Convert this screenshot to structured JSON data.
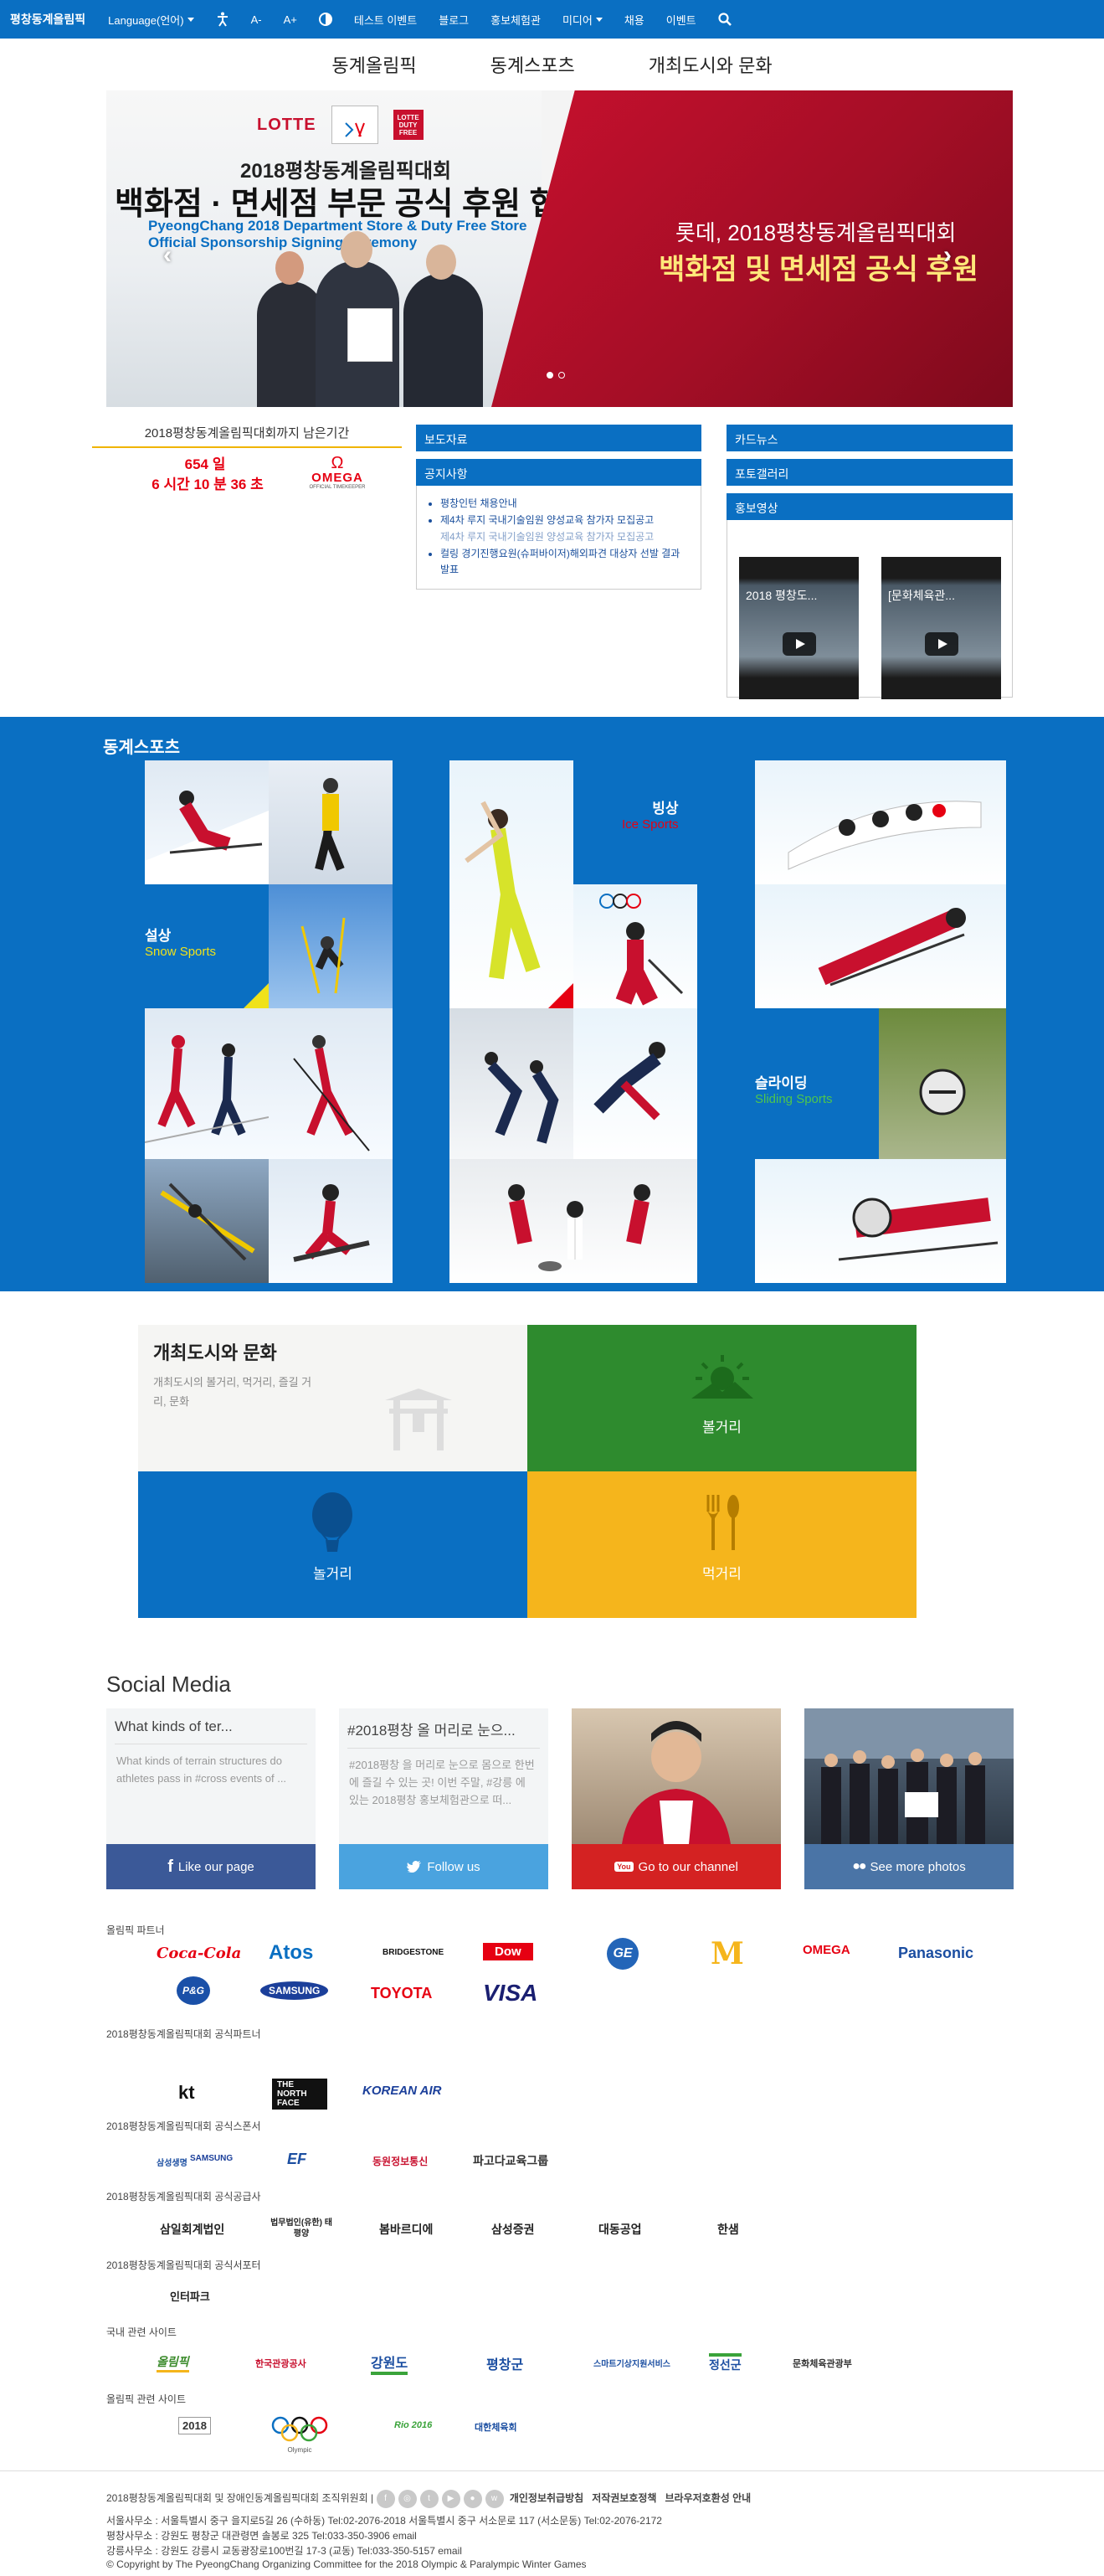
{
  "topbar": {
    "brand": "평창동계올림픽",
    "language": "Language(언어)",
    "font_minus": "A-",
    "font_plus": "A+",
    "menu": [
      "테스트 이벤트",
      "블로그",
      "홍보체험관",
      "미디어",
      "채용",
      "이벤트"
    ]
  },
  "subnav": [
    "동계올림픽",
    "동계스포츠",
    "개최도시와 문화"
  ],
  "hero": {
    "brand": "LOTTE",
    "duty_free": "LOTTE DUTY FREE",
    "title_small": "2018평창동계올림픽대회",
    "title_big": "백화점 · 면세점 부문 공식 후원 협약식",
    "title_en1": "PyeongChang 2018 Department Store & Duty Free Store",
    "title_en2": "Official Sponsorship Signing Ceremony",
    "right_line1": "롯데, 2018평창동계올림픽대회",
    "right_line2": "백화점 및 면세점 공식 후원"
  },
  "countdown": {
    "title": "2018평창동계올림픽대회까지 남은기간",
    "days": "654 일",
    "time": "6 시간 10 분 36 초",
    "sponsor": "OMEGA",
    "sponsor_sub": "OFFICIAL TIMEKEEPER"
  },
  "news": {
    "tab1": "보도자료",
    "tab2": "공지사항",
    "items": [
      "평창인턴 채용안내",
      "제4차 루지 국내기술임원 양성교육 참가자 모집공고",
      "제4차 루지 국내기술임원 양성교육 참가자 모집공고",
      "컬링 경기진행요원(슈퍼바이저)해외파견 대상자 선발 결과발표"
    ]
  },
  "right_panel": {
    "tab1": "카드뉴스",
    "tab2": "포토갤러리",
    "tab3": "홍보영상",
    "videos": [
      "2018 평창도...",
      "[문화체육관..."
    ]
  },
  "sports": {
    "title": "동계스포츠",
    "snow": {
      "ko": "설상",
      "en": "Snow Sports"
    },
    "ice": {
      "ko": "빙상",
      "en": "Ice Sports"
    },
    "sliding": {
      "ko": "슬라이딩",
      "en": "Sliding Sports"
    }
  },
  "culture": {
    "title": "개최도시와 문화",
    "desc": "개최도시의 볼거리, 먹거리, 즐길 거리, 문화",
    "q2": "볼거리",
    "q3": "놀거리",
    "q4": "먹거리"
  },
  "social": {
    "title": "Social Media",
    "cards": [
      {
        "title": "What kinds of ter...",
        "text": "What kinds of terrain structures do athletes pass in #cross events of ...",
        "button": "Like our page",
        "color": "#3b5998"
      },
      {
        "title": "#2018평창 올 머리로 눈으...",
        "text": "#2018평창 을 머리로 눈으로 몸으로 한번에 즐길 수 있는 곳! 이번 주말, #강릉 에 있는 2018평창 홍보체험관으로 떠...",
        "button": "Follow us",
        "color": "#4aa3df"
      },
      {
        "title": "",
        "text": "",
        "button": "Go to our channel",
        "color": "#d42222"
      },
      {
        "title": "",
        "text": "",
        "button": "See more photos",
        "color": "#4a74a6"
      }
    ]
  },
  "sponsors": {
    "headings": [
      "올림픽 파트너",
      "2018평창동계올림픽대회 공식파트너",
      "2018평창동계올림픽대회 공식스폰서",
      "2018평창동계올림픽대회 공식공급사",
      "2018평창동계올림픽대회 공식서포터",
      "국내 관련 사이트",
      "올림픽 관련 사이트"
    ],
    "olympic_partners": [
      "Coca-Cola",
      "Atos",
      "BRIDGESTONE",
      "Dow",
      "GE",
      "M",
      "OMEGA",
      "Panasonic",
      "P&G",
      "SAMSUNG",
      "TOYOTA",
      "VISA"
    ],
    "official_partners": [
      "kt",
      "THE NORTH FACE",
      "KOREAN AIR"
    ],
    "official_sponsors": [
      "삼성생명",
      "SAMSUNG",
      "EF",
      "동원정보통신",
      "파고다교육그룹"
    ],
    "suppliers": [
      "삼일회계법인",
      "법무법인(유한) 태평양",
      "봄바르디에",
      "삼성증권",
      "대동공업",
      "한샘"
    ],
    "supporters": [
      "인터파크"
    ],
    "domestic": [
      "올림픽",
      "한국관광공사",
      "강원도",
      "평창군",
      "스마트기상지원서비스",
      "정선군",
      "문화체육관광부"
    ],
    "olympic_sites": [
      "2018",
      "Olympic",
      "Rio 2016",
      "대한체육회"
    ]
  },
  "footer": {
    "line1_org": "2018평창동계올림픽대회 및 장애인동계올림픽대회 조직위원회",
    "links": [
      "개인정보취급방침",
      "저작권보호정책",
      "브라우저호환성 안내"
    ],
    "line2": "서울사무소 : 서울특별시 중구 을지로5길 26 (수하동) Tel:02-2076-2018 서울특별시 중구 서소문로 117 (서소문동) Tel:02-2076-2172",
    "line3": "평창사무소 : 강원도 평창군 대관령면 솔봉로 325 Tel:033-350-3906 email",
    "line4": "강릉사무소 : 강원도 강릉시 교동광장로100번길 17-3 (교동) Tel:033-350-5157 email",
    "copyright": "© Copyright by The PyeongChang Organizing Committee for the 2018 Olympic & Paralympic Winter Games"
  }
}
